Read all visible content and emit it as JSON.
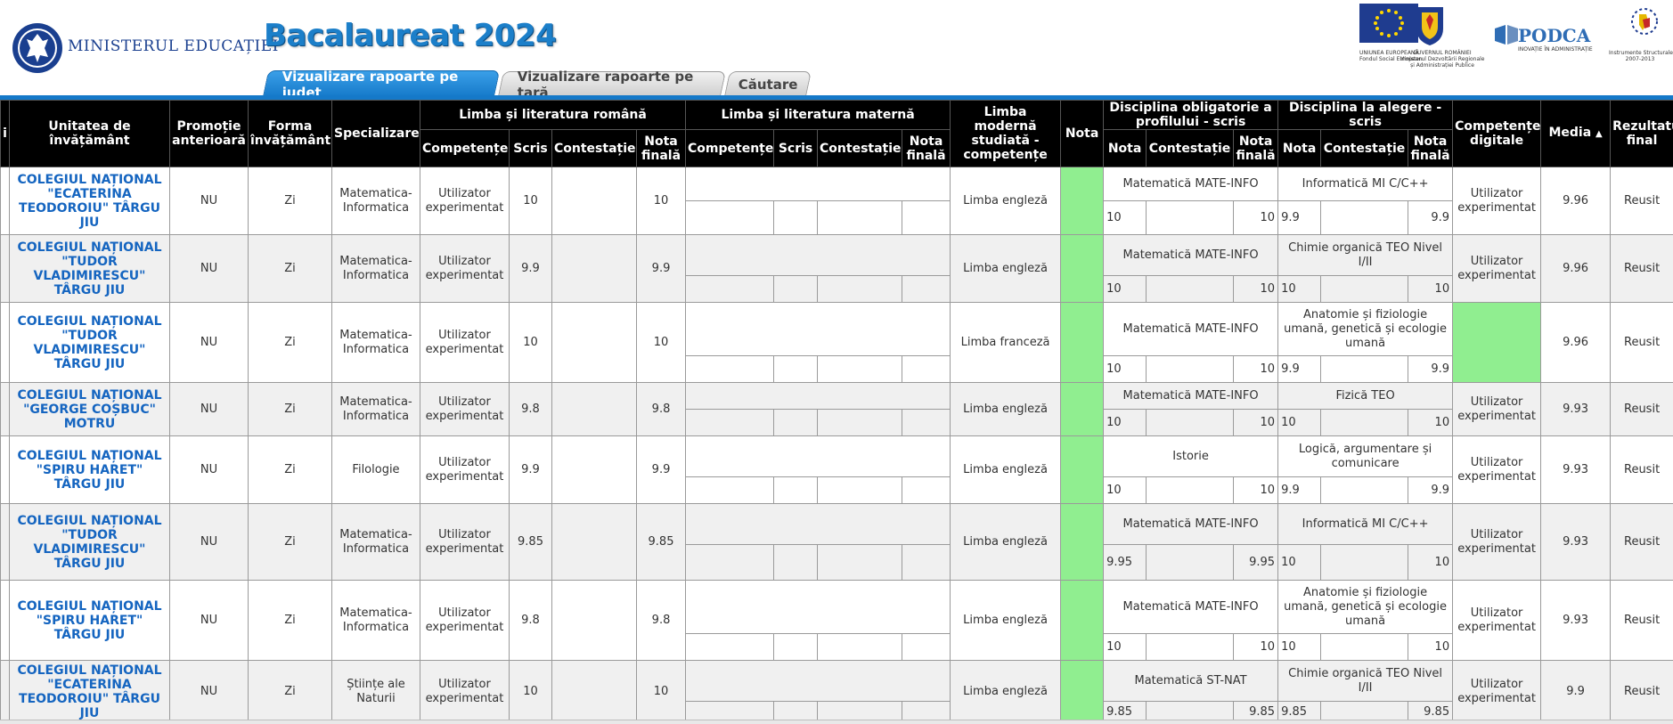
{
  "header": {
    "ministry": "MINISTERUL EDUCAȚIEI",
    "title": "Bacalaureat 2024",
    "partners": [
      {
        "name": "eu-flag",
        "caption": "UNIUNEA EUROPEANĂ\nFondul Social European"
      },
      {
        "name": "romania-coat",
        "caption": "GUVERNUL ROMÂNIEI\nMinisterul Dezvoltării Regionale\nși Administrației Publice"
      },
      {
        "name": "podca",
        "logo_text": "PODCA",
        "caption": "INOVAȚIE ÎN ADMINISTRAȚIE"
      },
      {
        "name": "instrumente-structurale",
        "caption": "Instrumente Structurale\n2007-2013"
      }
    ]
  },
  "tabs": [
    {
      "label": "Vizualizare rapoarte pe județ",
      "active": true
    },
    {
      "label": "Vizualizare rapoarte pe țară",
      "active": false
    },
    {
      "label": "Căutare",
      "active": false
    }
  ],
  "table": {
    "headers": {
      "first_partial": "i",
      "unitate": "Unitatea de învățământ",
      "promotie": "Promoție anterioară",
      "forma": "Forma învățământ",
      "specializare": "Specializare",
      "romana": "Limba și literatura română",
      "materna": "Limba și literatura maternă",
      "moderna": "Limba modernă studiată - competențe",
      "nota": "Nota",
      "obligatorie": "Disciplina obligatorie a profilului - scris",
      "alegere": "Disciplina la alegere - scris",
      "digitale": "Competențe digitale",
      "media": "Media",
      "rezultat": "Rezultatul final",
      "sub": {
        "competente": "Competențe",
        "scris": "Scris",
        "contestatie": "Contestație",
        "nota_finala": "Nota finală",
        "nota": "Nota"
      },
      "sort_icon": "▲"
    },
    "rows": [
      {
        "unitate": "COLEGIUL NAȚIONAL \"ECATERINA TEODOROIU\" TÂRGU JIU",
        "promotie": "NU",
        "forma": "Zi",
        "specializare": "Matematica-Informatica",
        "rom_comp": "Utilizator experimentat",
        "rom_scris": "10",
        "rom_cont": "",
        "rom_final": "10",
        "moderna": "Limba engleză",
        "obl_name": "Matematică MATE-INFO",
        "obl_nota": "10",
        "obl_cont": "",
        "obl_final": "10",
        "ale_name": "Informatică MI C/C++",
        "ale_nota": "9.9",
        "ale_cont": "",
        "ale_final": "9.9",
        "digitale": "Utilizator experimentat",
        "media": "9.96",
        "rezultat": "Reusit"
      },
      {
        "unitate": "COLEGIUL NAȚIONAL \"TUDOR VLADIMIRESCU\" TÂRGU JIU",
        "promotie": "NU",
        "forma": "Zi",
        "specializare": "Matematica-Informatica",
        "rom_comp": "Utilizator experimentat",
        "rom_scris": "9.9",
        "rom_cont": "",
        "rom_final": "9.9",
        "moderna": "Limba engleză",
        "obl_name": "Matematică MATE-INFO",
        "obl_nota": "10",
        "obl_cont": "",
        "obl_final": "10",
        "ale_name": "Chimie organică TEO Nivel I/II",
        "ale_nota": "10",
        "ale_cont": "",
        "ale_final": "10",
        "digitale": "Utilizator experimentat",
        "media": "9.96",
        "rezultat": "Reusit"
      },
      {
        "unitate": "COLEGIUL NAȚIONAL \"TUDOR VLADIMIRESCU\" TÂRGU JIU",
        "promotie": "NU",
        "forma": "Zi",
        "specializare": "Matematica-Informatica",
        "rom_comp": "Utilizator experimentat",
        "rom_scris": "10",
        "rom_cont": "",
        "rom_final": "10",
        "moderna": "Limba franceză",
        "obl_name": "Matematică MATE-INFO",
        "obl_nota": "10",
        "obl_cont": "",
        "obl_final": "10",
        "ale_name": "Anatomie și fiziologie umană, genetică și ecologie umană",
        "ale_nota": "9.9",
        "ale_cont": "",
        "ale_final": "9.9",
        "digitale": "",
        "digitale_green": true,
        "media": "9.96",
        "rezultat": "Reusit"
      },
      {
        "unitate": "COLEGIUL NAȚIONAL \"GEORGE COȘBUC\" MOTRU",
        "promotie": "NU",
        "forma": "Zi",
        "specializare": "Matematica-Informatica",
        "rom_comp": "Utilizator experimentat",
        "rom_scris": "9.8",
        "rom_cont": "",
        "rom_final": "9.8",
        "moderna": "Limba engleză",
        "obl_name": "Matematică MATE-INFO",
        "obl_nota": "10",
        "obl_cont": "",
        "obl_final": "10",
        "ale_name": "Fizică TEO",
        "ale_nota": "10",
        "ale_cont": "",
        "ale_final": "10",
        "digitale": "Utilizator experimentat",
        "media": "9.93",
        "rezultat": "Reusit"
      },
      {
        "unitate": "COLEGIUL NAȚIONAL \"SPIRU HARET\" TÂRGU JIU",
        "promotie": "NU",
        "forma": "Zi",
        "specializare": "Filologie",
        "rom_comp": "Utilizator experimentat",
        "rom_scris": "9.9",
        "rom_cont": "",
        "rom_final": "9.9",
        "moderna": "Limba engleză",
        "obl_name": "Istorie",
        "obl_nota": "10",
        "obl_cont": "",
        "obl_final": "10",
        "ale_name": "Logică, argumentare și comunicare",
        "ale_nota": "9.9",
        "ale_cont": "",
        "ale_final": "9.9",
        "digitale": "Utilizator experimentat",
        "media": "9.93",
        "rezultat": "Reusit"
      },
      {
        "unitate": "COLEGIUL NAȚIONAL \"TUDOR VLADIMIRESCU\" TÂRGU JIU",
        "promotie": "NU",
        "forma": "Zi",
        "specializare": "Matematica-Informatica",
        "rom_comp": "Utilizator experimentat",
        "rom_scris": "9.85",
        "rom_cont": "",
        "rom_final": "9.85",
        "moderna": "Limba engleză",
        "obl_name": "Matematică MATE-INFO",
        "obl_nota": "9.95",
        "obl_cont": "",
        "obl_final": "9.95",
        "ale_name": "Informatică MI C/C++",
        "ale_nota": "10",
        "ale_cont": "",
        "ale_final": "10",
        "digitale": "Utilizator experimentat",
        "media": "9.93",
        "rezultat": "Reusit"
      },
      {
        "unitate": "COLEGIUL NAȚIONAL \"SPIRU HARET\" TÂRGU JIU",
        "promotie": "NU",
        "forma": "Zi",
        "specializare": "Matematica-Informatica",
        "rom_comp": "Utilizator experimentat",
        "rom_scris": "9.8",
        "rom_cont": "",
        "rom_final": "9.8",
        "moderna": "Limba engleză",
        "obl_name": "Matematică MATE-INFO",
        "obl_nota": "10",
        "obl_cont": "",
        "obl_final": "10",
        "ale_name": "Anatomie și fiziologie umană, genetică și ecologie umană",
        "ale_nota": "10",
        "ale_cont": "",
        "ale_final": "10",
        "digitale": "Utilizator experimentat",
        "media": "9.93",
        "rezultat": "Reusit"
      },
      {
        "unitate": "COLEGIUL NAȚIONAL \"ECATERINA TEODOROIU\" TÂRGU JIU",
        "promotie": "NU",
        "forma": "Zi",
        "specializare": "Științe ale Naturii",
        "rom_comp": "Utilizator experimentat",
        "rom_scris": "10",
        "rom_cont": "",
        "rom_final": "10",
        "moderna": "Limba engleză",
        "obl_name": "Matematică ST-NAT",
        "obl_nota": "9.85",
        "obl_cont": "",
        "obl_final": "9.85",
        "ale_name": "Chimie organică TEO Nivel I/II",
        "ale_nota": "9.85",
        "ale_cont": "",
        "ale_final": "9.85",
        "digitale": "Utilizator experimentat",
        "media": "9.9",
        "rezultat": "Reusit"
      }
    ]
  },
  "colors": {
    "accent": "#1579c9",
    "unit_link": "#1565c0",
    "highlight_green": "#90ee90",
    "header_bg": "#000000"
  }
}
